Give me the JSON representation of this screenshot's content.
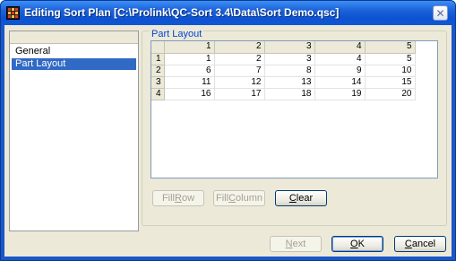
{
  "window": {
    "title": "Editing Sort Plan [C:\\Prolink\\QC-Sort 3.4\\Data\\Sort Demo.qsc]",
    "close_glyph": "✕"
  },
  "sidebar": {
    "items": [
      {
        "label": "General",
        "selected": false
      },
      {
        "label": "Part Layout",
        "selected": true
      }
    ]
  },
  "part_layout": {
    "group_label": "Part Layout",
    "columns": [
      "1",
      "2",
      "3",
      "4",
      "5"
    ],
    "rows": [
      {
        "header": "1",
        "cells": [
          "1",
          "2",
          "3",
          "4",
          "5"
        ]
      },
      {
        "header": "2",
        "cells": [
          "6",
          "7",
          "8",
          "9",
          "10"
        ]
      },
      {
        "header": "3",
        "cells": [
          "11",
          "12",
          "13",
          "14",
          "15"
        ]
      },
      {
        "header": "4",
        "cells": [
          "16",
          "17",
          "18",
          "19",
          "20"
        ]
      }
    ],
    "buttons": {
      "fill_row": {
        "pre": "Fill ",
        "key": "R",
        "post": "ow"
      },
      "fill_column": {
        "pre": "Fill ",
        "key": "C",
        "post": "olumn"
      },
      "clear": {
        "pre": "",
        "key": "C",
        "post": "lear"
      }
    }
  },
  "footer": {
    "next": {
      "pre": "",
      "key": "N",
      "post": "ext"
    },
    "ok": {
      "pre": "",
      "key": "O",
      "post": "K"
    },
    "cancel": {
      "pre": "",
      "key": "C",
      "post": "ancel"
    }
  }
}
